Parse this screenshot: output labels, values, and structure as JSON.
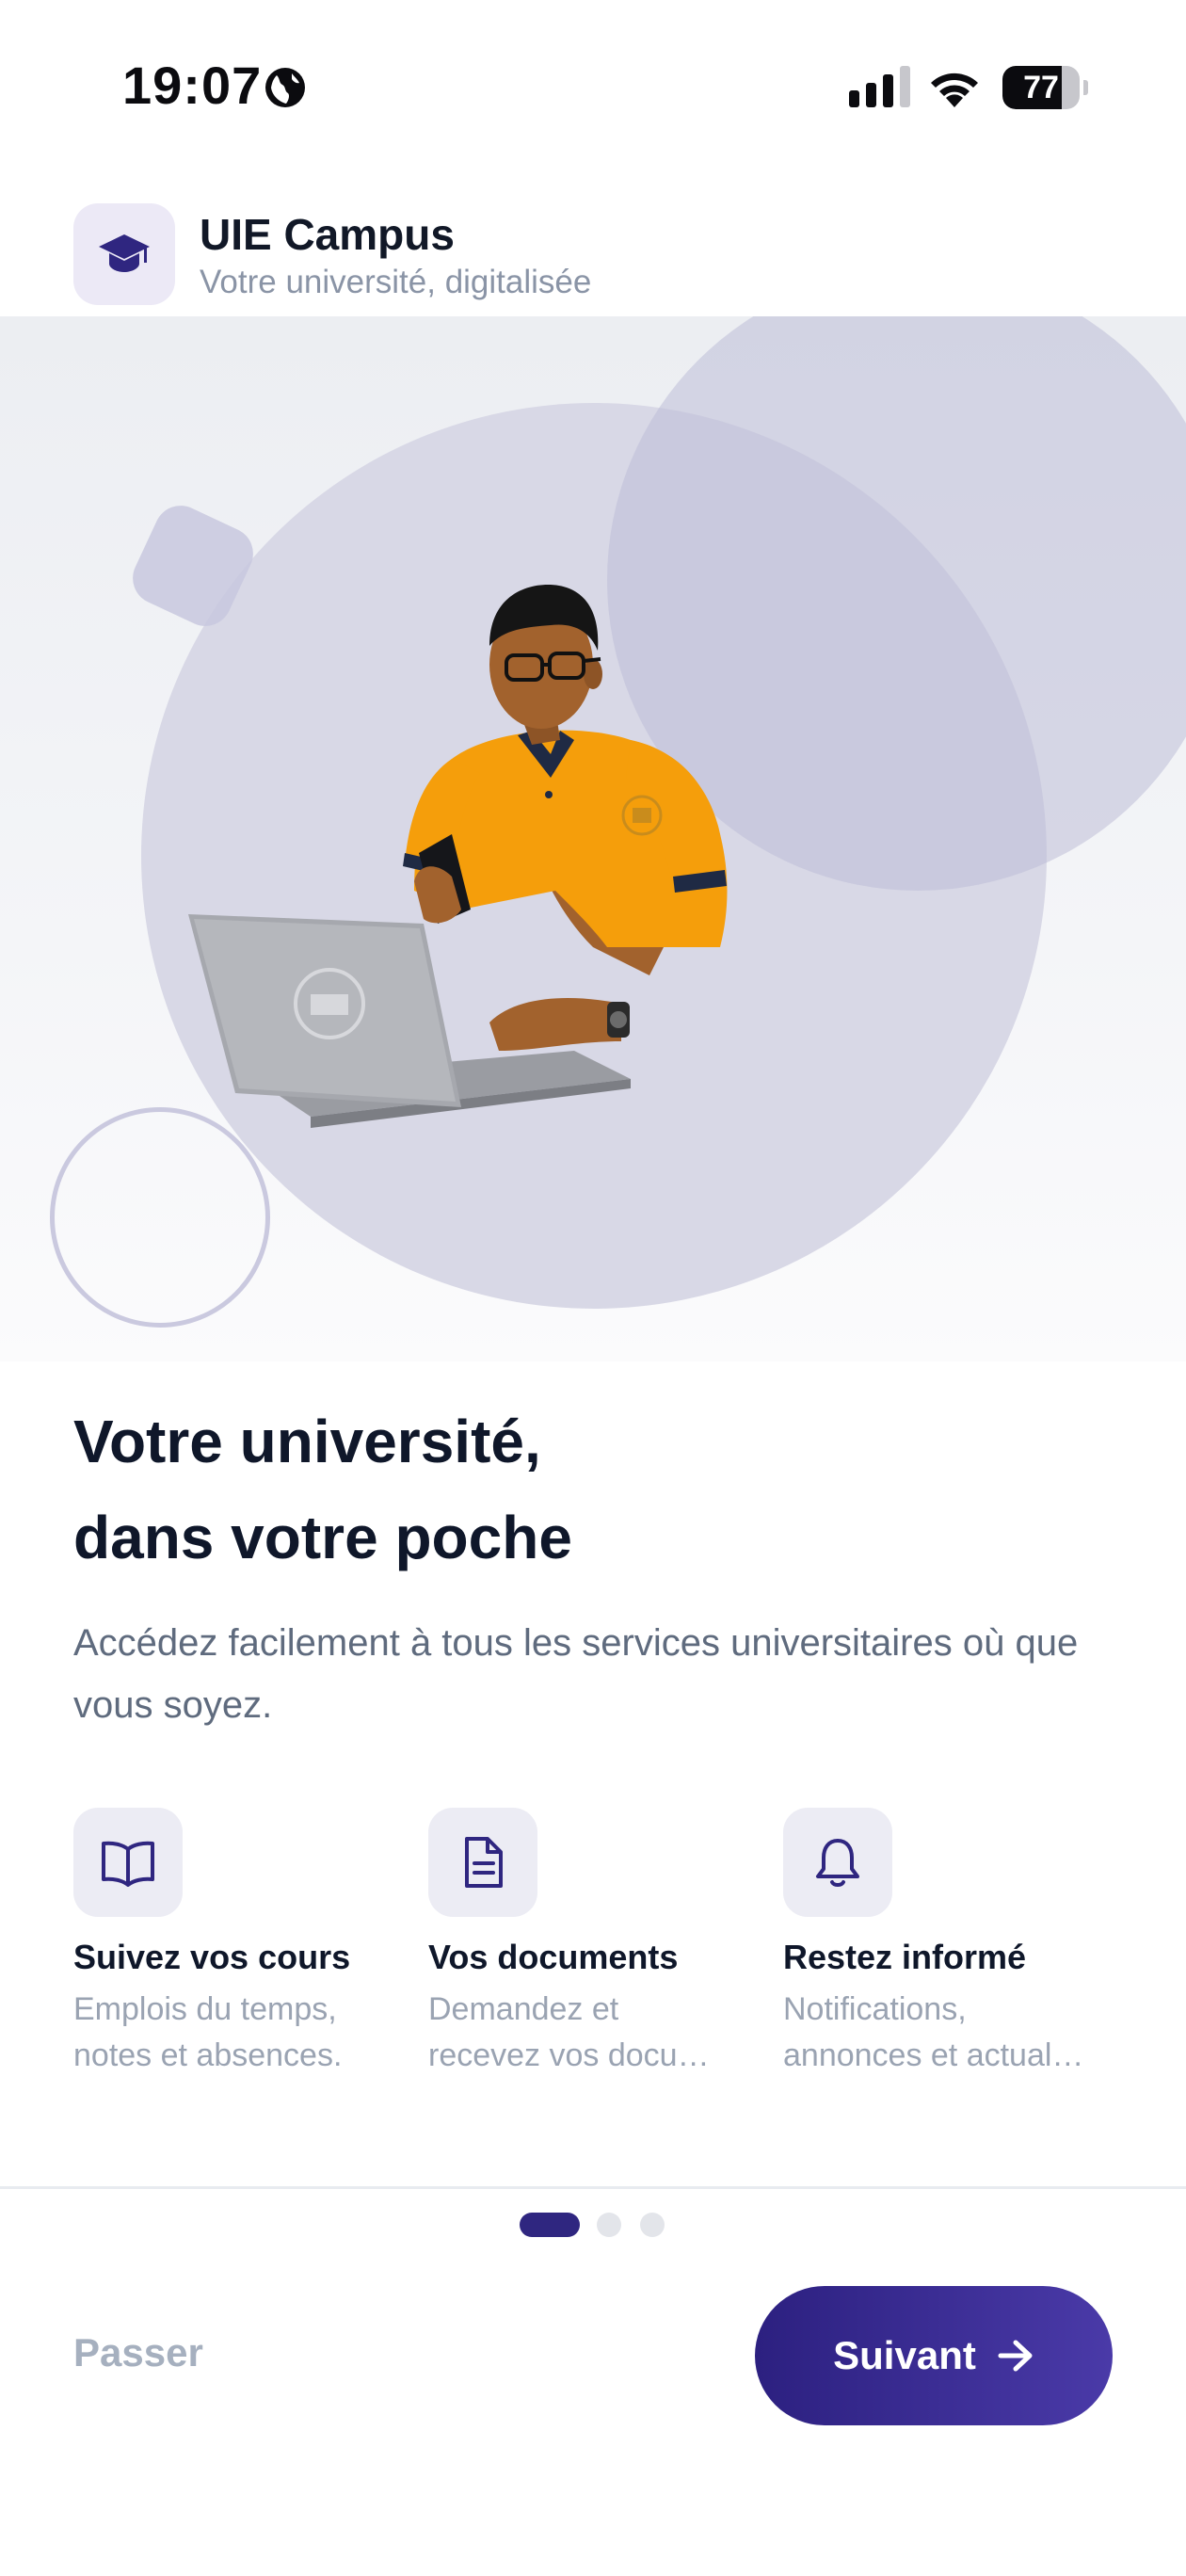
{
  "status_bar": {
    "time": "19:07",
    "battery": "77",
    "battery_level": 0.77,
    "icons": [
      "globe-icon",
      "cellular-signal-icon",
      "wifi-icon",
      "battery-icon"
    ]
  },
  "header": {
    "app_name": "UIE Campus",
    "tagline": "Votre université, digitalisée",
    "logo_icon": "graduation-cap-icon"
  },
  "hero": {
    "illustration": "student-with-laptop-and-phone"
  },
  "content": {
    "headline_line1": "Votre université,",
    "headline_line2": "dans votre poche",
    "description": "Accédez facilement à tous les services universitaires où que vous soyez."
  },
  "features": [
    {
      "icon": "book-icon",
      "title": "Suivez vos cours",
      "desc_line1": "Emplois du temps,",
      "desc_line2": "notes et absences."
    },
    {
      "icon": "document-icon",
      "title": "Vos documents",
      "desc_line1": "Demandez et",
      "desc_line2": "recevez vos docu…"
    },
    {
      "icon": "bell-icon",
      "title": "Restez informé",
      "desc_line1": "Notifications,",
      "desc_line2": "annonces et actual…"
    }
  ],
  "pagination": {
    "current": 1,
    "total": 3
  },
  "footer": {
    "skip_label": "Passer",
    "next_label": "Suivant"
  },
  "colors": {
    "primary": "#2f2680",
    "primary_light": "#4a3aa8",
    "accent_orange": "#f59e0b",
    "text_dark": "#0f172a",
    "text_muted": "#9aa3b2"
  }
}
